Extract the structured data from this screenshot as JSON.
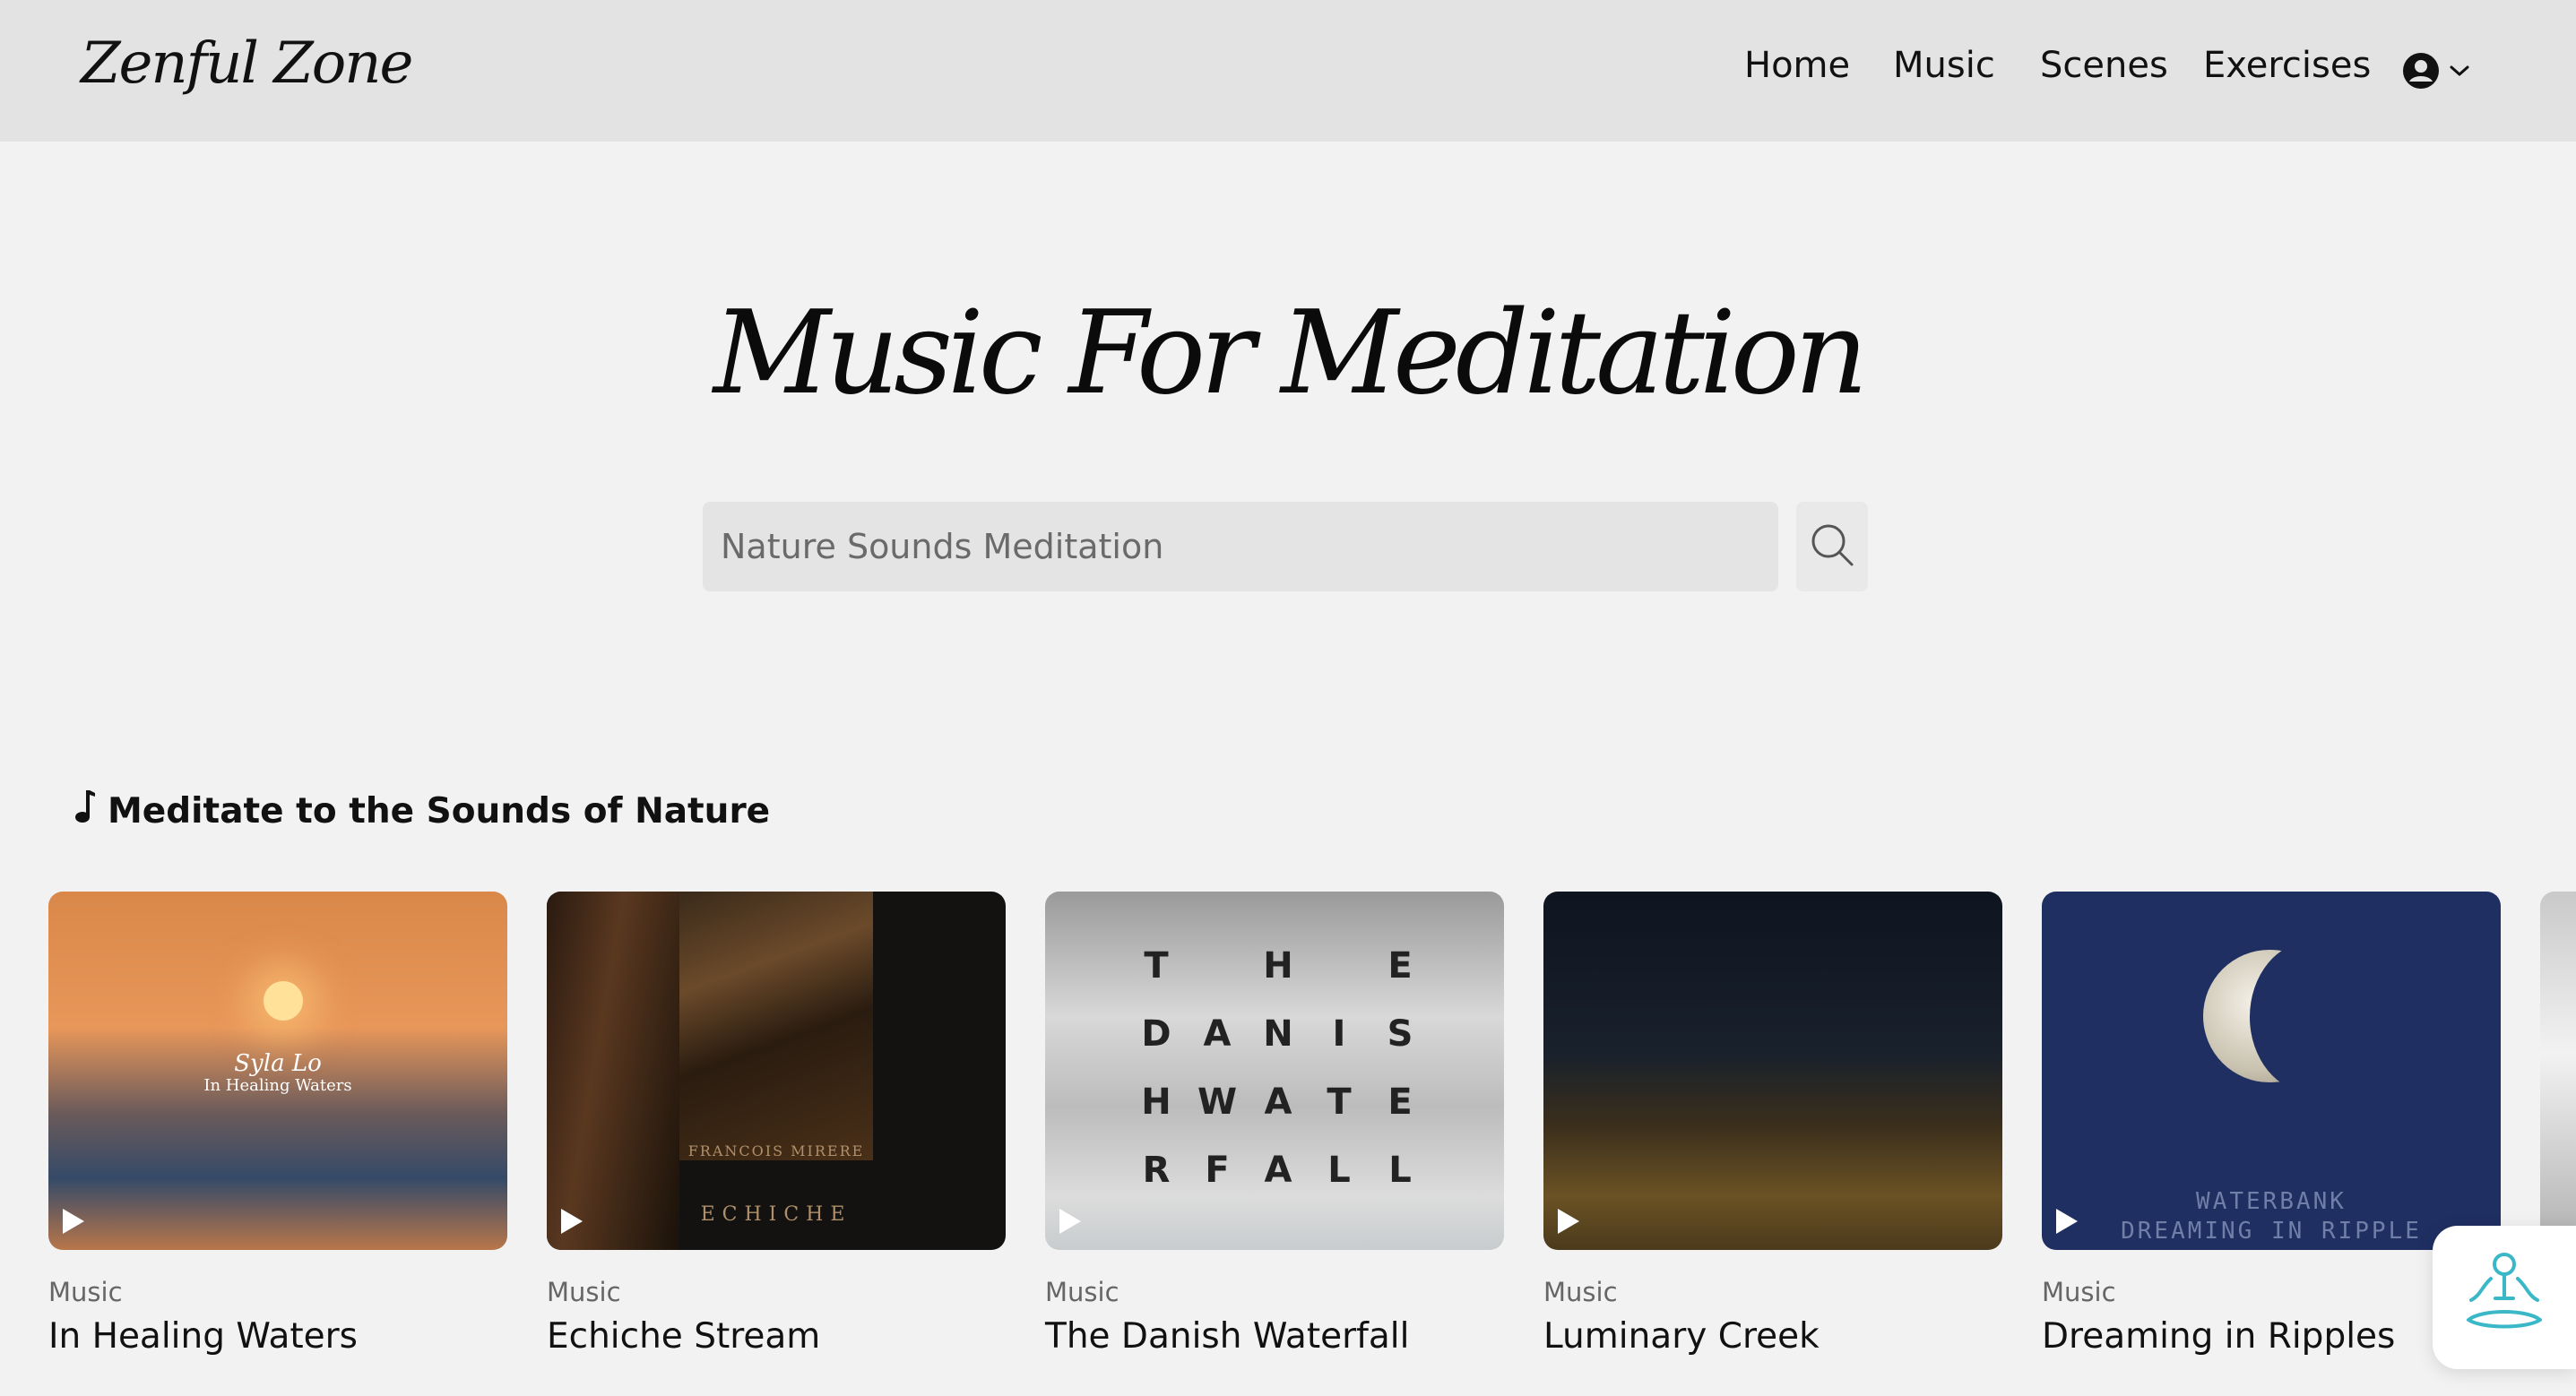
{
  "app": {
    "logo": "Zenful Zone"
  },
  "nav": {
    "items": [
      "Home",
      "Music",
      "Scenes",
      "Exercises"
    ]
  },
  "hero": {
    "title": "Music For Meditation",
    "search_placeholder": "Nature Sounds Meditation"
  },
  "section": {
    "title": "Meditate to the Sounds of Nature",
    "icon": "music-note-icon"
  },
  "cards": [
    {
      "category": "Music",
      "title": "In Healing Waters",
      "cover_text": [
        "Syla Lo",
        "In Healing Waters"
      ]
    },
    {
      "category": "Music",
      "title": "Echiche Stream",
      "cover_text": [
        "FRANCOIS MIRERE",
        "ECHICHE"
      ]
    },
    {
      "category": "Music",
      "title": "The Danish Waterfall",
      "cover_text": [
        "T",
        "H",
        "E",
        "D",
        "A",
        "N",
        "I",
        "S",
        "H",
        "W",
        "A",
        "T",
        "E",
        "R",
        "F",
        "A",
        "L",
        "L"
      ]
    },
    {
      "category": "Music",
      "title": "Luminary Creek",
      "cover_text": []
    },
    {
      "category": "Music",
      "title": "Dreaming in Ripples",
      "cover_text": [
        "WATERBANK",
        "DREAMING IN RIPPLE"
      ]
    }
  ],
  "colors": {
    "header_bg": "#e3e3e3",
    "page_bg": "#f2f2f2",
    "fab_icon": "#3ab8c8"
  },
  "icons": {
    "account": "user-circle-icon",
    "dropdown": "chevron-down-icon",
    "search": "search-icon",
    "play": "play-icon",
    "fab": "meditation-pose-icon"
  }
}
